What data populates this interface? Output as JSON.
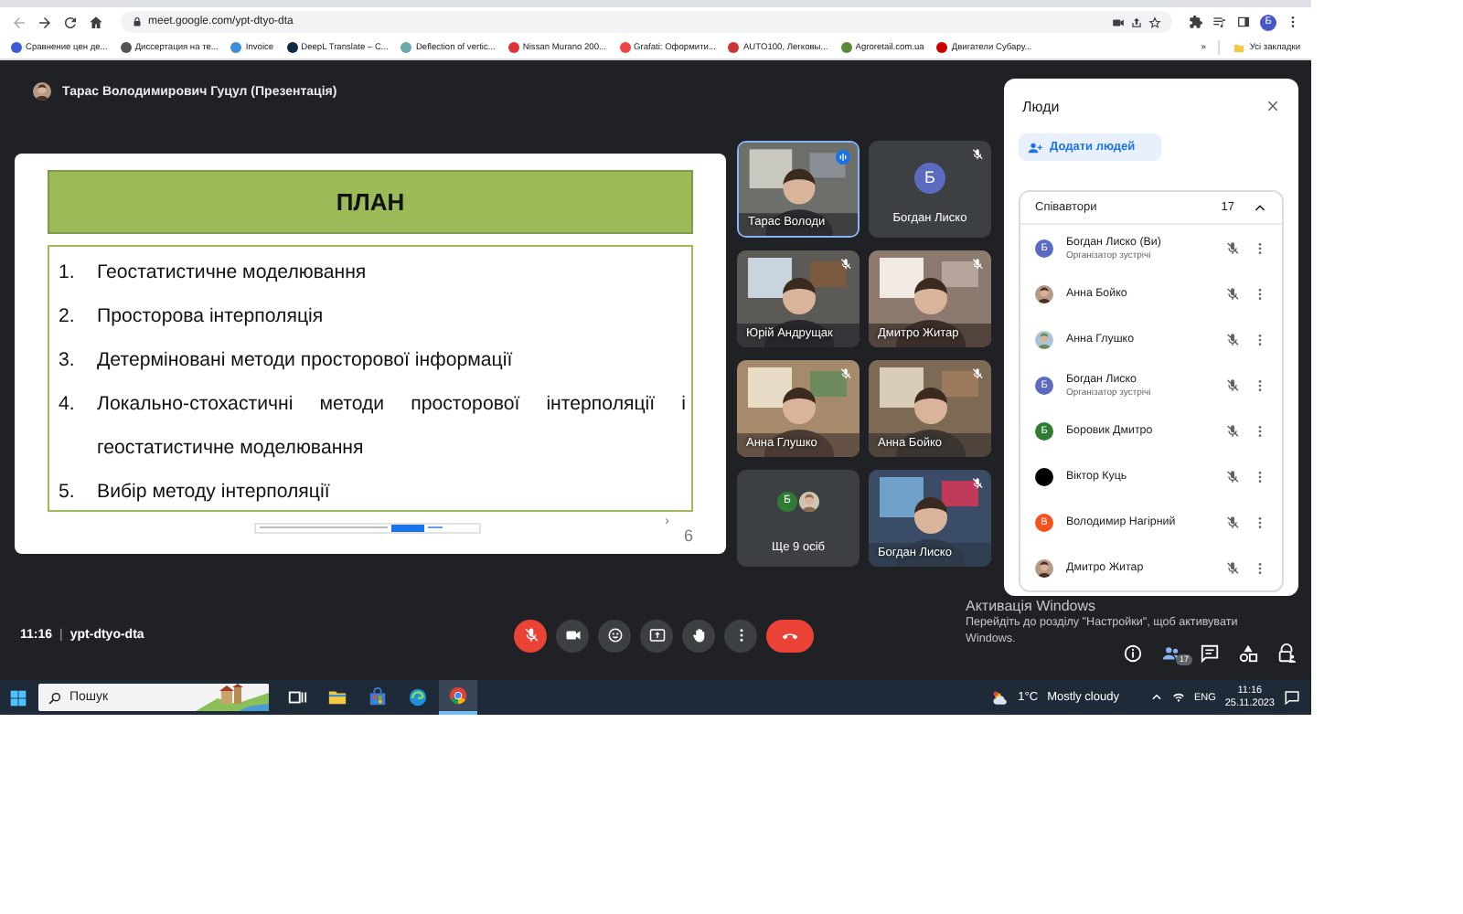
{
  "browser": {
    "url": "meet.google.com/ypt-dtyo-dta",
    "profile_initial": "Б",
    "bookmarks": [
      {
        "label": "Сравнение цен де..."
      },
      {
        "label": "Диссертация на те..."
      },
      {
        "label": "Invoice"
      },
      {
        "label": "DeepL Translate – C..."
      },
      {
        "label": "Deflection of vertic..."
      },
      {
        "label": "Nissan Murano 200..."
      },
      {
        "label": "Grafati: Оформити..."
      },
      {
        "label": "AUTO100, Легковы..."
      },
      {
        "label": "Agroretail.com.ua"
      },
      {
        "label": "Двигатели Субару..."
      }
    ],
    "more": "»",
    "all_bookmarks": "Усі закладки"
  },
  "meeting": {
    "presenter_title": "Тарас Володимирович Гуцул (Презентація)",
    "slide": {
      "title": "ПЛАН",
      "items": [
        {
          "number": "1.",
          "text": "Геостатистичне моделювання"
        },
        {
          "number": "2.",
          "text": "Просторова інтерполяція"
        },
        {
          "number": "3.",
          "text": "Детерміновані методи просторової інформації"
        },
        {
          "number": "4.",
          "text": "Локально-стохастичні методи просторової інтерполяції і геостатистичне моделювання"
        },
        {
          "number": "5.",
          "text": "Вибір методу інтерполяції"
        }
      ],
      "arrow": "›",
      "page": "6"
    },
    "tiles": [
      {
        "kind": "video",
        "name": "Тарас Володи",
        "speaking": true,
        "muted": false
      },
      {
        "kind": "avatar",
        "name": "Богдан Лиско",
        "initial": "Б",
        "color": "#5c6bc0",
        "speaking": false,
        "muted": true
      },
      {
        "kind": "video",
        "name": "Юрій Андрущак",
        "speaking": false,
        "muted": true
      },
      {
        "kind": "video",
        "name": "Дмитро Житар",
        "speaking": false,
        "muted": true
      },
      {
        "kind": "video",
        "name": "Анна Глушко",
        "speaking": false,
        "muted": true
      },
      {
        "kind": "video",
        "name": "Анна Бойко",
        "speaking": false,
        "muted": true
      },
      {
        "kind": "more",
        "name": "Ще 9 осіб",
        "initial": "Б",
        "color": "#2e7d32",
        "speaking": false,
        "muted": false
      },
      {
        "kind": "video",
        "name": "Богдан Лиско",
        "speaking": false,
        "muted": true
      }
    ]
  },
  "people": {
    "title": "Люди",
    "add_label": "Додати людей",
    "section": "Співавтори",
    "count": "17",
    "expanded": true,
    "participants": [
      {
        "name": "Богдан Лиско (Ви)",
        "role": "Організатор зустрічі",
        "kind": "initial",
        "initial": "Б",
        "color": "#5c6bc0",
        "muted": true
      },
      {
        "name": "Анна Бойко",
        "muted": true
      },
      {
        "name": "Анна Глушко",
        "muted": true
      },
      {
        "name": "Богдан Лиско",
        "role": "Організатор зустрічі",
        "kind": "initial",
        "initial": "Б",
        "color": "#5c6bc0",
        "muted": true
      },
      {
        "name": "Боровик Дмитро",
        "kind": "initial",
        "initial": "Б",
        "color": "#2e7d32",
        "muted": true
      },
      {
        "name": "Віктор Куць",
        "kind": "initial",
        "color": "#000000",
        "muted": true
      },
      {
        "name": "Володимир Нагірний",
        "kind": "initial",
        "initial": "В",
        "color": "#f4511e",
        "muted": true
      },
      {
        "name": "Дмитро Житар",
        "muted": true
      }
    ]
  },
  "call": {
    "time": "11:16",
    "separator": "|",
    "code": "ypt-dtyo-dta",
    "controls": [
      {
        "kind": "mic",
        "muted": true
      },
      {
        "kind": "camera"
      },
      {
        "kind": "emoji"
      },
      {
        "kind": "present"
      },
      {
        "kind": "hand"
      },
      {
        "kind": "more"
      },
      {
        "kind": "leave"
      }
    ],
    "side_buttons": [
      {
        "kind": "info",
        "selected": false
      },
      {
        "kind": "people",
        "selected": true,
        "badge": "17"
      },
      {
        "kind": "chat",
        "selected": false
      },
      {
        "kind": "activities",
        "selected": false
      },
      {
        "kind": "host",
        "selected": false
      }
    ]
  },
  "windows_activation": {
    "title": "Активація Windows",
    "text": "Перейдіть до розділу \"Настройки\", щоб активувати Windows."
  },
  "taskbar": {
    "search_placeholder": "Пошук",
    "apps": [
      {
        "kind": "taskview",
        "selected": false
      },
      {
        "kind": "explorer",
        "selected": false
      },
      {
        "kind": "store",
        "selected": false
      },
      {
        "kind": "edge",
        "selected": false
      },
      {
        "kind": "chrome",
        "selected": true
      }
    ],
    "temperature": "1°C",
    "weather": "Mostly cloudy",
    "language": "ENG",
    "time": "11:16",
    "date": "25.11.2023"
  }
}
